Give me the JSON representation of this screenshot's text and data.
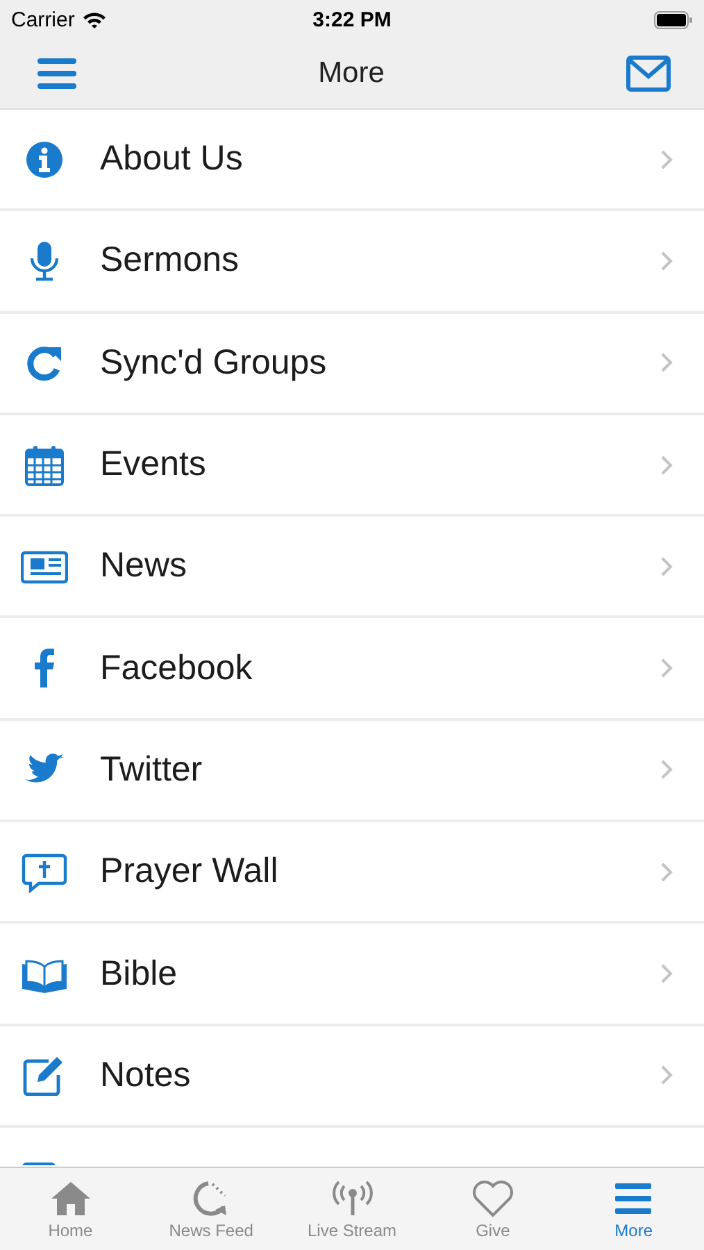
{
  "status_bar": {
    "carrier": "Carrier",
    "time": "3:22 PM"
  },
  "nav_bar": {
    "title": "More"
  },
  "menu": [
    {
      "label": "About Us"
    },
    {
      "label": "Sermons"
    },
    {
      "label": "Sync'd Groups"
    },
    {
      "label": "Events"
    },
    {
      "label": "News"
    },
    {
      "label": "Facebook"
    },
    {
      "label": "Twitter"
    },
    {
      "label": "Prayer Wall"
    },
    {
      "label": "Bible"
    },
    {
      "label": "Notes"
    }
  ],
  "tab_bar": [
    {
      "label": "Home",
      "selected": false
    },
    {
      "label": "News Feed",
      "selected": false
    },
    {
      "label": "Live Stream",
      "selected": false
    },
    {
      "label": "Give",
      "selected": false
    },
    {
      "label": "More",
      "selected": true
    }
  ]
}
